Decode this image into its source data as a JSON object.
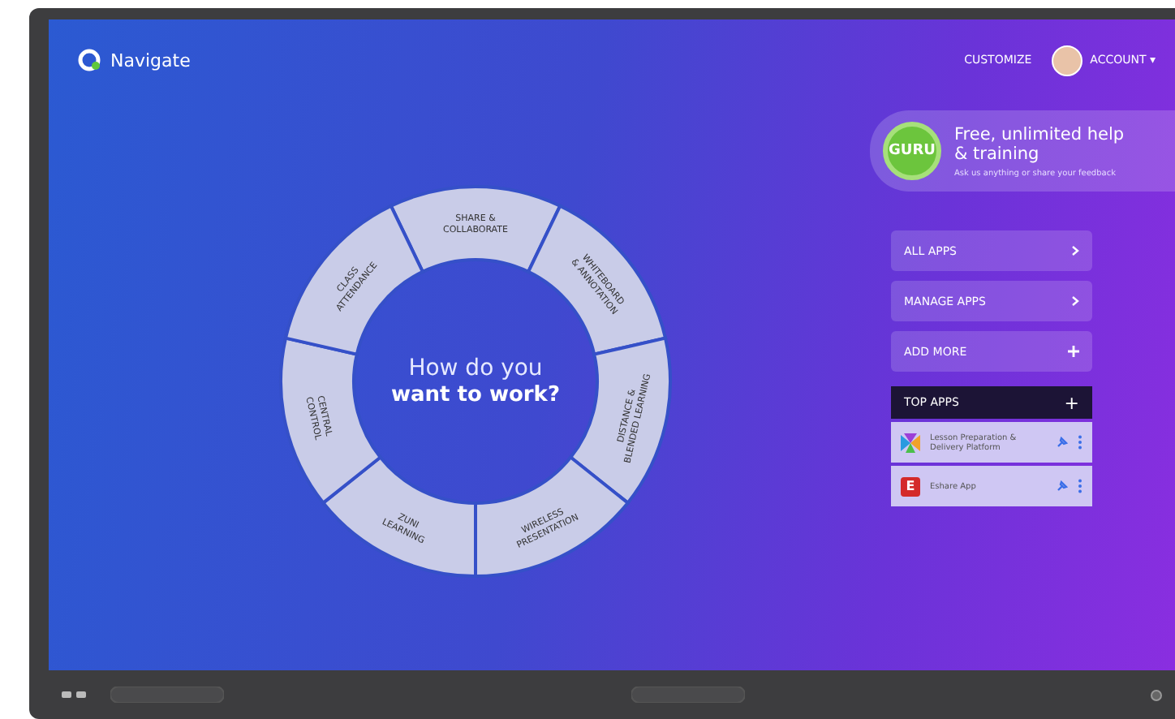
{
  "header": {
    "brand": "Navigate",
    "customize": "CUSTOMIZE",
    "account": "ACCOUNT",
    "account_caret": "▾"
  },
  "wheel": {
    "prompt": "How do you",
    "prompt_bold": "want to work?",
    "segments": [
      {
        "lines": [
          "SHARE &",
          "COLLABORATE"
        ]
      },
      {
        "lines": [
          "WHITEBOARD",
          "& ANNOTATION"
        ]
      },
      {
        "lines": [
          "DISTANCE &",
          "BLENDED LEARNING"
        ]
      },
      {
        "lines": [
          "WIRELESS",
          "PRESENTATION"
        ]
      },
      {
        "lines": [
          "ZUNI",
          "LEARNING"
        ]
      },
      {
        "lines": [
          "CENTRAL",
          "CONTROL"
        ]
      },
      {
        "lines": [
          "CLASS",
          "ATTENDANCE"
        ]
      }
    ]
  },
  "help_card": {
    "badge": "GURU",
    "title": "Free, unlimited help",
    "title_line2": "& training",
    "subtitle": "Ask us anything or share your feedback"
  },
  "menu": [
    {
      "label": "ALL APPS",
      "kind": "open"
    },
    {
      "label": "MANAGE APPS",
      "kind": "open"
    },
    {
      "label": "ADD MORE",
      "kind": "add"
    }
  ],
  "top_apps": {
    "title": "TOP APPS",
    "add": "+",
    "items": [
      {
        "name": "Lesson Preparation & Delivery Platform",
        "kind": "bow",
        "pinned": true
      },
      {
        "name": "Eshare App",
        "kind": "letter",
        "letter": "E",
        "pinned": true
      }
    ]
  }
}
